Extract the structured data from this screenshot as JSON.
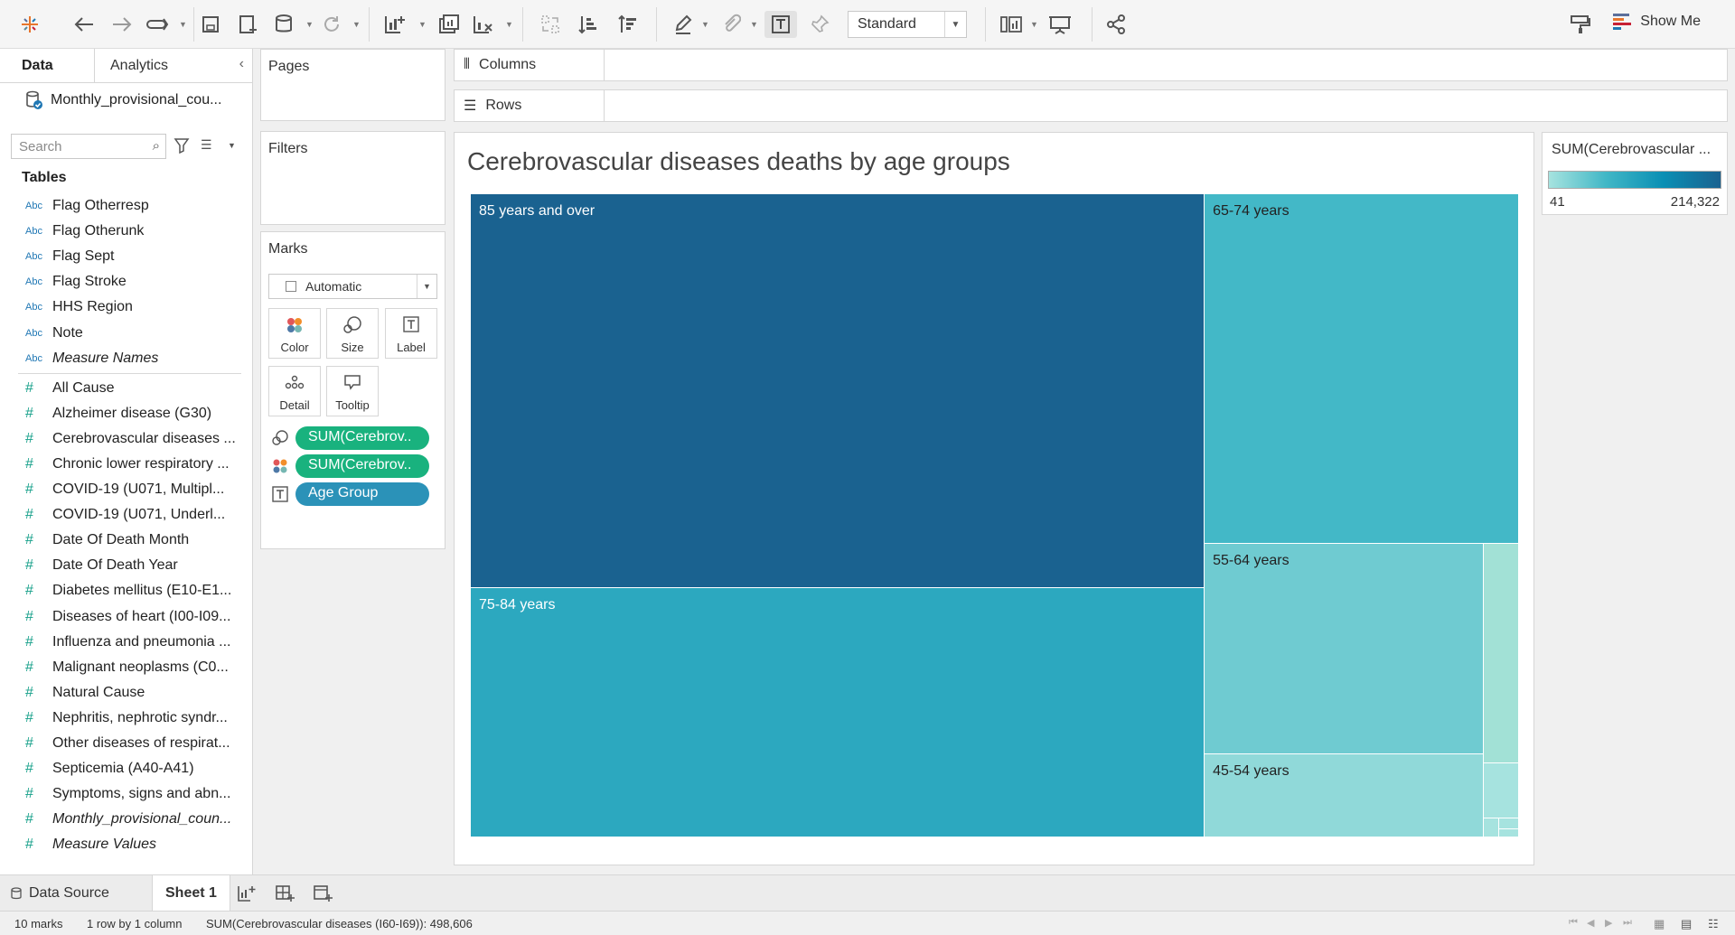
{
  "toolbar": {
    "view_mode": "Standard",
    "show_me": "Show Me"
  },
  "datapane": {
    "tabs": [
      "Data",
      "Analytics"
    ],
    "datasource_name": "Monthly_provisional_cou...",
    "search_placeholder": "Search",
    "tables_heading": "Tables",
    "dimensions": [
      {
        "type": "Abc",
        "name": "Flag Otherresp"
      },
      {
        "type": "Abc",
        "name": "Flag Otherunk"
      },
      {
        "type": "Abc",
        "name": "Flag Sept"
      },
      {
        "type": "Abc",
        "name": "Flag Stroke"
      },
      {
        "type": "Abc",
        "name": "HHS Region"
      },
      {
        "type": "Abc",
        "name": "Note"
      },
      {
        "type": "Abc",
        "name": "Measure Names"
      }
    ],
    "measures": [
      {
        "type": "#",
        "name": "All Cause"
      },
      {
        "type": "#",
        "name": "Alzheimer disease (G30)"
      },
      {
        "type": "#",
        "name": "Cerebrovascular diseases ..."
      },
      {
        "type": "#",
        "name": "Chronic lower respiratory ..."
      },
      {
        "type": "#",
        "name": "COVID-19 (U071, Multipl..."
      },
      {
        "type": "#",
        "name": "COVID-19 (U071, Underl..."
      },
      {
        "type": "#",
        "name": "Date Of Death Month"
      },
      {
        "type": "#",
        "name": "Date Of Death Year"
      },
      {
        "type": "#",
        "name": "Diabetes mellitus (E10-E1..."
      },
      {
        "type": "#",
        "name": "Diseases of heart (I00-I09..."
      },
      {
        "type": "#",
        "name": "Influenza and pneumonia ..."
      },
      {
        "type": "#",
        "name": "Malignant neoplasms (C0..."
      },
      {
        "type": "#",
        "name": "Natural Cause"
      },
      {
        "type": "#",
        "name": "Nephritis, nephrotic syndr..."
      },
      {
        "type": "#",
        "name": "Other diseases of respirat..."
      },
      {
        "type": "#",
        "name": "Septicemia (A40-A41)"
      },
      {
        "type": "#",
        "name": "Symptoms, signs and abn..."
      },
      {
        "type": "#",
        "name": "Monthly_provisional_coun..."
      },
      {
        "type": "#",
        "name": "Measure Values"
      }
    ]
  },
  "cards": {
    "pages": "Pages",
    "filters": "Filters",
    "marks": "Marks",
    "mark_type": "Automatic",
    "buttons": [
      "Color",
      "Size",
      "Label",
      "Detail",
      "Tooltip"
    ],
    "pills": [
      {
        "label": "SUM(Cerebrov..",
        "encoding": "size"
      },
      {
        "label": "SUM(Cerebrov..",
        "encoding": "color"
      },
      {
        "label": "Age Group",
        "encoding": "label"
      }
    ]
  },
  "shelves": {
    "columns": "Columns",
    "rows": "Rows"
  },
  "viz": {
    "title": "Cerebrovascular diseases deaths by age groups"
  },
  "legend": {
    "title": "SUM(Cerebrovascular ...",
    "min": "41",
    "max": "214,322",
    "colors": [
      "#a6e3df",
      "#1a6290"
    ]
  },
  "chart_data": {
    "type": "treemap",
    "title": "Cerebrovascular diseases deaths by age groups",
    "measure": "SUM(Cerebrovascular diseases (I60-I69))",
    "total": 498606,
    "labelled_segments": [
      {
        "label": "85 years and over",
        "value": 214322
      },
      {
        "label": "75-84 years",
        "value": 110000
      },
      {
        "label": "65-74 years",
        "value": 84000
      },
      {
        "label": "55-64 years",
        "value": 47000
      },
      {
        "label": "45-54 years",
        "value": 19000
      }
    ],
    "unlabelled_segment_count": 5,
    "color_range": [
      41,
      214322
    ]
  },
  "bottom": {
    "data_source": "Data Source",
    "sheet": "Sheet 1"
  },
  "status": {
    "marks": "10 marks",
    "dims": "1 row by 1 column",
    "sum": "SUM(Cerebrovascular diseases (I60-I69)): 498,606"
  }
}
